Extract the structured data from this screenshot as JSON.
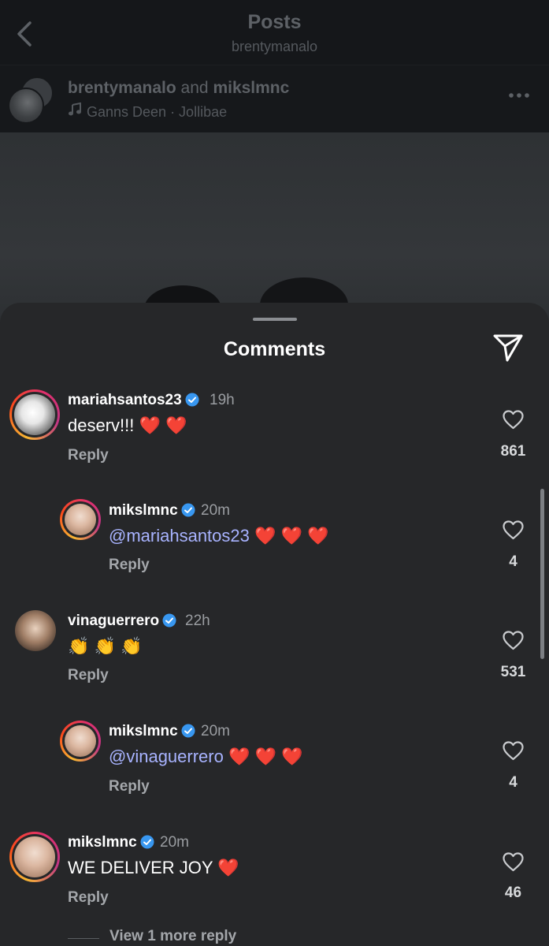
{
  "header": {
    "title": "Posts",
    "subtitle": "brentymanalo"
  },
  "post": {
    "user1": "brentymanalo",
    "conjunction": "and",
    "user2": "mikslmnc",
    "music": "Ganns Deen · Jollibae"
  },
  "sheet": {
    "title": "Comments"
  },
  "comments": [
    {
      "username": "mariahsantos23",
      "time": "19h",
      "text": "deserv!!! ❤️ ❤️",
      "mention": "",
      "reply": "Reply",
      "likes": "861"
    },
    {
      "username": "mikslmnc",
      "time": "20m",
      "mention": "@mariahsantos23",
      "text": " ❤️ ❤️ ❤️",
      "reply": "Reply",
      "likes": "4"
    },
    {
      "username": "vinaguerrero",
      "time": "22h",
      "text": "👏 👏 👏",
      "mention": "",
      "reply": "Reply",
      "likes": "531"
    },
    {
      "username": "mikslmnc",
      "time": "20m",
      "mention": "@vinaguerrero",
      "text": " ❤️ ❤️ ❤️",
      "reply": "Reply",
      "likes": "4"
    },
    {
      "username": "mikslmnc",
      "time": "20m",
      "text": "WE DELIVER JOY ❤️",
      "mention": "",
      "reply": "Reply",
      "likes": "46"
    }
  ],
  "view_more": "View 1 more reply",
  "colors": {
    "background": "#262729",
    "mention": "#a8b3ff",
    "verified": "#3897f0"
  },
  "icons": [
    "back-icon",
    "music-icon",
    "more-icon",
    "send-icon",
    "verified-icon",
    "heart-icon"
  ]
}
